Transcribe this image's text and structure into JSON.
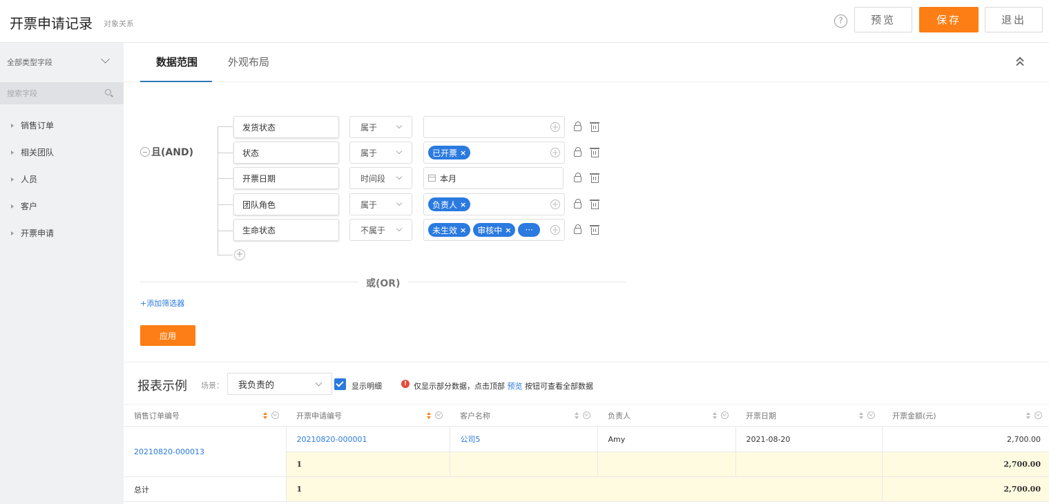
{
  "header": {
    "title": "开票申请记录",
    "subtitle": "对象关系",
    "help": "?",
    "preview_label": "预览",
    "save_label": "保存",
    "exit_label": "退出"
  },
  "sidebar": {
    "field_type": "全部类型字段",
    "search_placeholder": "搜索字段",
    "items": [
      {
        "label": "销售订单"
      },
      {
        "label": "相关团队"
      },
      {
        "label": "人员"
      },
      {
        "label": "客户"
      },
      {
        "label": "开票申请"
      }
    ]
  },
  "tabs": [
    {
      "label": "数据范围",
      "active": true
    },
    {
      "label": "外观布局",
      "active": false
    }
  ],
  "filter": {
    "and_label": "且(AND)",
    "conditions": [
      {
        "field": "发货状态",
        "operator": "属于",
        "tags": []
      },
      {
        "field": "状态",
        "operator": "属于",
        "tags": [
          "已开票"
        ]
      },
      {
        "field": "开票日期",
        "operator": "时间段",
        "date": "本月"
      },
      {
        "field": "团队角色",
        "operator": "属于",
        "tags": [
          "负责人"
        ]
      },
      {
        "field": "生命状态",
        "operator": "不属于",
        "tags": [
          "未生效",
          "审核中"
        ],
        "more": "···"
      }
    ],
    "or_label": "或(OR)",
    "add_filter_label": "+添加筛选器",
    "apply_label": "应用"
  },
  "report": {
    "title": "报表示例",
    "scene_label": "场景：",
    "scene_value": "我负责的",
    "show_detail_label": "显示明细",
    "notice_before": "仅显示部分数据，点击顶部",
    "notice_link": "预览",
    "notice_after": "按钮可查看全部数据",
    "columns": [
      "销售订单编号",
      "开票申请编号",
      "客户名称",
      "负责人",
      "开票日期",
      "开票金额(元)"
    ],
    "rows": {
      "order_no": "20210820-000013",
      "invoice_no": "20210820-000001",
      "customer": "公司5",
      "owner": "Amy",
      "date": "2021-08-20",
      "amount": "2,700.00",
      "sub_count": "1",
      "sub_amount": "2,700.00"
    },
    "total": {
      "label": "总计",
      "count": "1",
      "amount": "2,700.00"
    }
  }
}
